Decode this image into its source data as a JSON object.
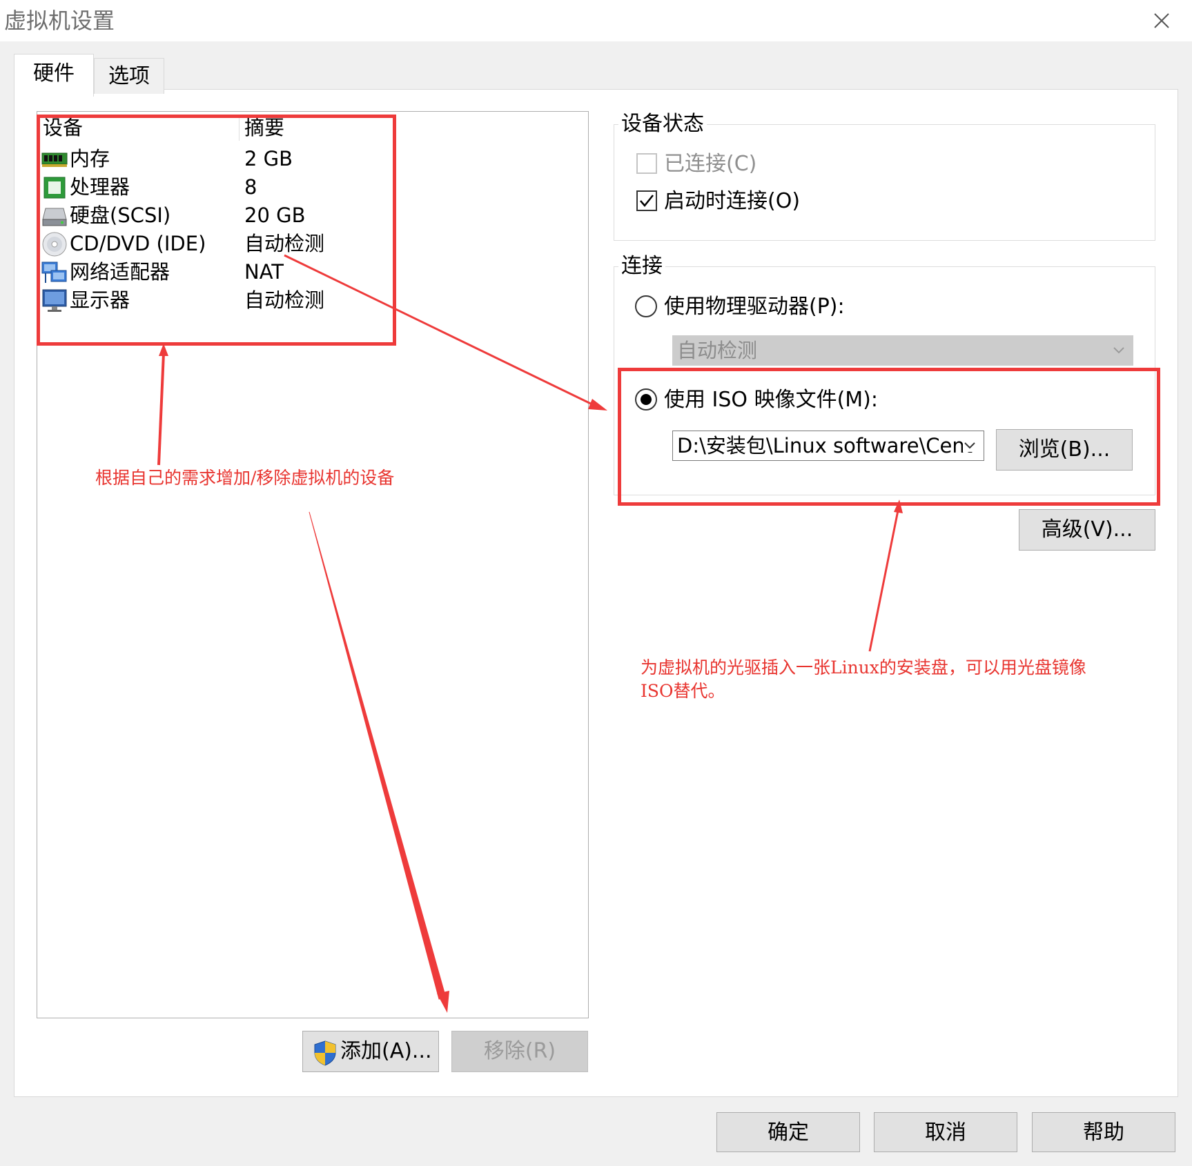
{
  "window": {
    "title": "虚拟机设置"
  },
  "tabs": [
    {
      "label": "硬件",
      "active": true
    },
    {
      "label": "选项",
      "active": false
    }
  ],
  "device_list": {
    "columns": [
      "设备",
      "摘要"
    ],
    "rows": [
      {
        "name": "内存",
        "summary": "2 GB",
        "icon": "memory-icon"
      },
      {
        "name": "处理器",
        "summary": "8",
        "icon": "processor-icon"
      },
      {
        "name": "硬盘(SCSI)",
        "summary": "20 GB",
        "icon": "hard-disk-icon"
      },
      {
        "name": "CD/DVD (IDE)",
        "summary": "自动检测",
        "icon": "cd-dvd-icon"
      },
      {
        "name": "网络适配器",
        "summary": "NAT",
        "icon": "network-adapter-icon"
      },
      {
        "name": "显示器",
        "summary": "自动检测",
        "icon": "display-icon"
      }
    ]
  },
  "buttons": {
    "add": "添加(A)...",
    "remove": "移除(R)",
    "browse": "浏览(B)...",
    "advanced": "高级(V)...",
    "ok": "确定",
    "cancel": "取消",
    "help": "帮助"
  },
  "device_status": {
    "title": "设备状态",
    "connected": {
      "label": "已连接(C)",
      "checked": false,
      "enabled": false
    },
    "connect_at_power_on": {
      "label": "启动时连接(O)",
      "checked": true
    }
  },
  "connection": {
    "title": "连接",
    "physical_drive": {
      "label": "使用物理驱动器(P):",
      "selected": false,
      "value": "自动检测"
    },
    "iso_image": {
      "label": "使用 ISO 映像文件(M):",
      "selected": true,
      "value": "D:\\安装包\\Linux software\\Cent"
    }
  },
  "annotations": {
    "left": "根据自己的需求增加/移除虚拟机的设备",
    "right_line1": "为虚拟机的光驱插入一张Linux的安装盘，可以用光盘镜像",
    "right_line2": "ISO替代。"
  },
  "colors": {
    "annotation_red": "#ee3b3b",
    "window_bg": "#f0f0f0",
    "disabled_combo": "#cccccc"
  }
}
